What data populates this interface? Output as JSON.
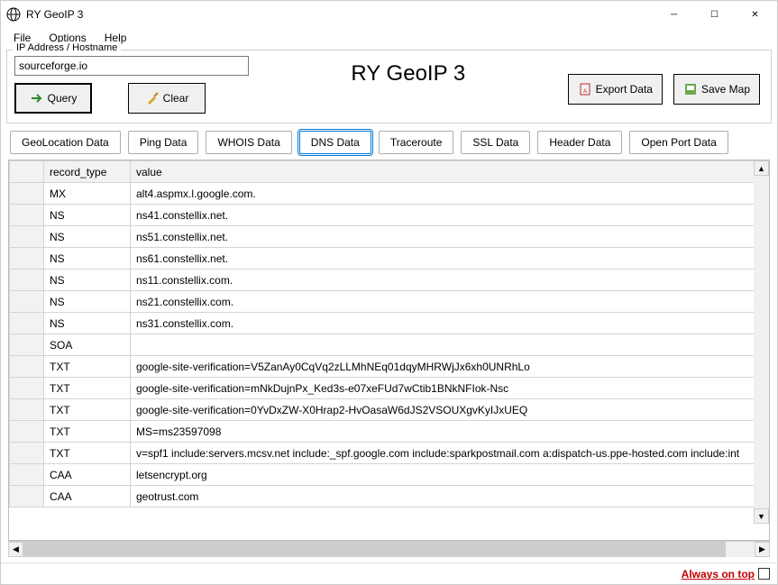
{
  "window": {
    "title": "RY GeoIP 3"
  },
  "menu": {
    "file": "File",
    "options": "Options",
    "help": "Help"
  },
  "fieldset": {
    "legend": "IP Address / Hostname"
  },
  "input": {
    "value": "sourceforge.io"
  },
  "buttons": {
    "query": "Query",
    "clear": "Clear",
    "export": "Export Data",
    "savemap": "Save Map"
  },
  "appTitle": "RY GeoIP 3",
  "tabs": {
    "geo": "GeoLocation Data",
    "ping": "Ping Data",
    "whois": "WHOIS Data",
    "dns": "DNS Data",
    "trace": "Traceroute",
    "ssl": "SSL Data",
    "header": "Header Data",
    "port": "Open Port Data"
  },
  "columns": {
    "record_type": "record_type",
    "value": "value"
  },
  "rows": [
    {
      "record_type": "MX",
      "value": "alt4.aspmx.l.google.com."
    },
    {
      "record_type": "NS",
      "value": "ns41.constellix.net."
    },
    {
      "record_type": "NS",
      "value": "ns51.constellix.net."
    },
    {
      "record_type": "NS",
      "value": "ns61.constellix.net."
    },
    {
      "record_type": "NS",
      "value": "ns11.constellix.com."
    },
    {
      "record_type": "NS",
      "value": "ns21.constellix.com."
    },
    {
      "record_type": "NS",
      "value": "ns31.constellix.com."
    },
    {
      "record_type": "SOA",
      "value": ""
    },
    {
      "record_type": "TXT",
      "value": "google-site-verification=V5ZanAy0CqVq2zLLMhNEq01dqyMHRWjJx6xh0UNRhLo"
    },
    {
      "record_type": "TXT",
      "value": "google-site-verification=mNkDujnPx_Ked3s-e07xeFUd7wCtib1BNkNFIok-Nsc"
    },
    {
      "record_type": "TXT",
      "value": "google-site-verification=0YvDxZW-X0Hrap2-HvOasaW6dJS2VSOUXgvKyIJxUEQ"
    },
    {
      "record_type": "TXT",
      "value": "MS=ms23597098"
    },
    {
      "record_type": "TXT",
      "value": "v=spf1 include:servers.mcsv.net include:_spf.google.com include:sparkpostmail.com a:dispatch-us.ppe-hosted.com include:int"
    },
    {
      "record_type": "CAA",
      "value": "letsencrypt.org"
    },
    {
      "record_type": "CAA",
      "value": "geotrust.com"
    }
  ],
  "status": {
    "alwaysOnTop": "Always on top"
  }
}
